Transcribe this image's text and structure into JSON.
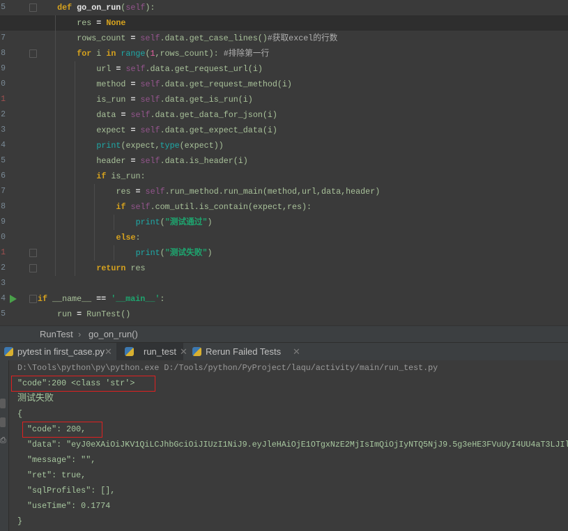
{
  "editor": {
    "line_numbers": [
      "5",
      "6",
      "7",
      "8",
      "9",
      "0",
      "1",
      "2",
      "3",
      "4",
      "5",
      "6",
      "7",
      "8",
      "9",
      "0",
      "1",
      "2",
      "3",
      "4",
      "5"
    ],
    "current_line_index": 1,
    "lines": [
      {
        "indent": 1,
        "tokens": [
          [
            "kw",
            "def "
          ],
          [
            "fn",
            "go_on_run"
          ],
          [
            "id",
            "("
          ],
          [
            "self",
            "self"
          ],
          [
            "id",
            "):"
          ]
        ]
      },
      {
        "indent": 2,
        "tokens": [
          [
            "id",
            "res "
          ],
          [
            "op",
            "="
          ],
          [
            "kw",
            " None"
          ]
        ]
      },
      {
        "indent": 2,
        "tokens": [
          [
            "id",
            "rows_count "
          ],
          [
            "op",
            "="
          ],
          [
            "self",
            " self"
          ],
          [
            "id",
            ".data.get_case_lines()"
          ],
          [
            "cm",
            "#获取excel的行数"
          ]
        ]
      },
      {
        "indent": 2,
        "tokens": [
          [
            "kw",
            "for"
          ],
          [
            "id",
            " i "
          ],
          [
            "kw",
            "in"
          ],
          [
            "bi",
            " range"
          ],
          [
            "id",
            "("
          ],
          [
            "num",
            "1"
          ],
          [
            "id",
            ",rows_count): "
          ],
          [
            "cm",
            "#排除第一行"
          ]
        ]
      },
      {
        "indent": 3,
        "tokens": [
          [
            "id",
            "url "
          ],
          [
            "op",
            "="
          ],
          [
            "self",
            " self"
          ],
          [
            "id",
            ".data.get_request_url(i)"
          ]
        ]
      },
      {
        "indent": 3,
        "tokens": [
          [
            "id",
            "method "
          ],
          [
            "op",
            "="
          ],
          [
            "self",
            " self"
          ],
          [
            "id",
            ".data.get_request_method(i)"
          ]
        ]
      },
      {
        "indent": 3,
        "tokens": [
          [
            "id",
            "is_run "
          ],
          [
            "op",
            "="
          ],
          [
            "self",
            " self"
          ],
          [
            "id",
            ".data.get_is_run(i)"
          ]
        ]
      },
      {
        "indent": 3,
        "tokens": [
          [
            "id",
            "data "
          ],
          [
            "op",
            "="
          ],
          [
            "self",
            " self"
          ],
          [
            "id",
            ".data.get_data_for_json(i)"
          ]
        ]
      },
      {
        "indent": 3,
        "tokens": [
          [
            "id",
            "expect "
          ],
          [
            "op",
            "="
          ],
          [
            "self",
            " self"
          ],
          [
            "id",
            ".data.get_expect_data(i)"
          ]
        ]
      },
      {
        "indent": 3,
        "tokens": [
          [
            "bi",
            "print"
          ],
          [
            "id",
            "(expect,"
          ],
          [
            "bi",
            "type"
          ],
          [
            "id",
            "(expect))"
          ]
        ]
      },
      {
        "indent": 3,
        "tokens": [
          [
            "id",
            "header "
          ],
          [
            "op",
            "="
          ],
          [
            "self",
            " self"
          ],
          [
            "id",
            ".data.is_header(i)"
          ]
        ]
      },
      {
        "indent": 3,
        "tokens": [
          [
            "kw",
            "if"
          ],
          [
            "id",
            " is_run:"
          ]
        ]
      },
      {
        "indent": 4,
        "tokens": [
          [
            "id",
            "res "
          ],
          [
            "op",
            "="
          ],
          [
            "self",
            " self"
          ],
          [
            "id",
            ".run_method.run_main(method,url,data,header)"
          ]
        ]
      },
      {
        "indent": 4,
        "tokens": [
          [
            "kw",
            "if"
          ],
          [
            "self",
            " self"
          ],
          [
            "id",
            ".com_util.is_contain(expect,res):"
          ]
        ]
      },
      {
        "indent": 5,
        "tokens": [
          [
            "bi",
            "print"
          ],
          [
            "id",
            "("
          ],
          [
            "str",
            "\"测试通过\""
          ],
          [
            "id",
            ")"
          ]
        ]
      },
      {
        "indent": 4,
        "tokens": [
          [
            "kw",
            "else"
          ],
          [
            "id",
            ":"
          ]
        ]
      },
      {
        "indent": 5,
        "tokens": [
          [
            "bi",
            "print"
          ],
          [
            "id",
            "("
          ],
          [
            "str",
            "\"测试失败\""
          ],
          [
            "id",
            ")"
          ]
        ]
      },
      {
        "indent": 3,
        "tokens": [
          [
            "kw",
            "return"
          ],
          [
            "id",
            " res"
          ]
        ]
      },
      {
        "indent": 0,
        "tokens": []
      },
      {
        "indent": 0,
        "tokens": [
          [
            "kw",
            "if"
          ],
          [
            "id",
            " __name__ "
          ],
          [
            "op",
            "=="
          ],
          [
            "str",
            " '__main__'"
          ],
          [
            "id",
            ":"
          ]
        ]
      },
      {
        "indent": 1,
        "tokens": [
          [
            "id",
            "run "
          ],
          [
            "op",
            "="
          ],
          [
            "id",
            " RunTest()"
          ]
        ]
      }
    ]
  },
  "breadcrumb": {
    "class_name": "RunTest",
    "separator": "›",
    "method": "go_on_run()"
  },
  "tabs": [
    {
      "label": "pytest in first_case.py",
      "active": false
    },
    {
      "label": "run_test",
      "active": true
    },
    {
      "label": "Rerun Failed Tests",
      "active": false
    }
  ],
  "console": {
    "command": "D:\\Tools\\python\\py\\python.exe D:/Tools/python/PyProject/laqu/activity/main/run_test.py",
    "output": [
      "\"code\":200 <class 'str'>",
      "测试失败",
      "{",
      "  \"code\": 200,",
      "  \"data\": \"eyJ0eXAiOiJKV1QiLCJhbGciOiJIUzI1NiJ9.eyJleHAiOjE1OTgxNzE2MjIsImQiOjIyNTQ5NjJ9.5g3eHE3FVuUyI4UU4aT3LJIl",
      "  \"message\": \"\",",
      "  \"ret\": true,",
      "  \"sqlProfiles\": [],",
      "  \"useTime\": 0.1774",
      "}"
    ],
    "highlight_color": "#e02020"
  }
}
